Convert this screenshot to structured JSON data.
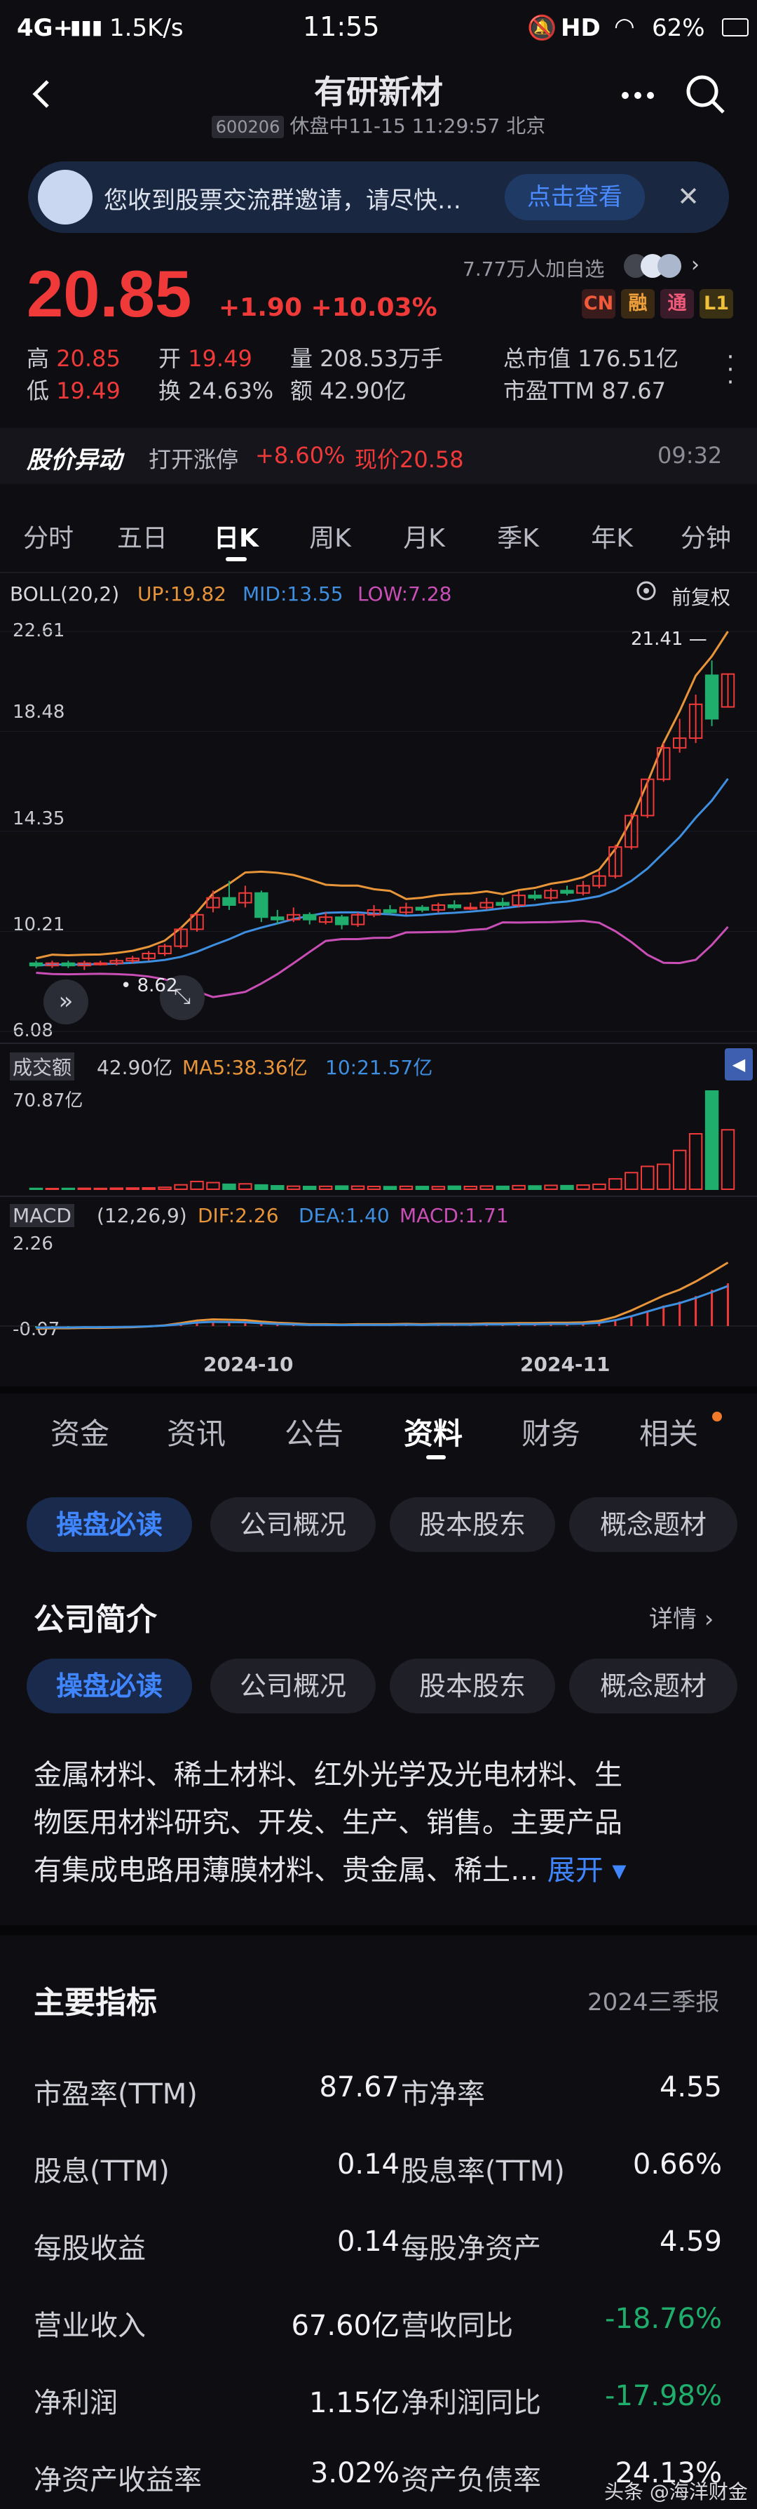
{
  "status_bar": {
    "network": "4G+",
    "speed": "1.5K/s",
    "time": "11:55",
    "right": "HD",
    "battery": "62%"
  },
  "header": {
    "title": "有研新材",
    "code": "600206",
    "status": "休盘中11-15 11:29:57 北京"
  },
  "banner": {
    "text": "您收到股票交流群邀请，请尽快…",
    "action": "点击查看"
  },
  "quote": {
    "price": "20.85",
    "change": "+1.90",
    "change_pct": "+10.03%",
    "watchers": "7.77万人加自选",
    "tags": [
      "CN",
      "融",
      "通",
      "L1"
    ],
    "stats": [
      {
        "label": "高",
        "value": "20.85",
        "color": "red"
      },
      {
        "label": "开",
        "value": "19.49",
        "color": "red"
      },
      {
        "label": "量",
        "value": "208.53万手",
        "color": "plain"
      },
      {
        "label": "总市值",
        "value": "176.51亿",
        "color": "plain"
      },
      {
        "label": "低",
        "value": "19.49",
        "color": "red"
      },
      {
        "label": "换",
        "value": "24.63%",
        "color": "plain"
      },
      {
        "label": "额",
        "value": "42.90亿",
        "color": "plain"
      },
      {
        "label": "市盈TTM",
        "value": "87.67",
        "color": "plain"
      }
    ]
  },
  "alert": {
    "title": "股价异动",
    "text": "打开涨停",
    "pct": "+8.60%",
    "price": "现价20.58",
    "time": "09:32"
  },
  "period_tabs": [
    "分时",
    "五日",
    "日K",
    "周K",
    "月K",
    "季K",
    "年K",
    "分钟"
  ],
  "period_active": 2,
  "chart": {
    "boll_label": "BOLL(20,2)",
    "up": "UP:19.82",
    "mid": "MID:13.55",
    "low": "LOW:7.28",
    "adjust": "前复权",
    "y_ticks": [
      "22.61",
      "18.48",
      "14.35",
      "10.21",
      "6.08"
    ],
    "high_mark": "21.41",
    "low_mark": "8.62",
    "vol_label": "成交额",
    "vol_value": "42.90亿",
    "ma5": "MA5:38.36亿",
    "ma10": "10:21.57亿",
    "vol_max": "70.87亿",
    "macd_label": "MACD",
    "macd_params": "(12,26,9)",
    "dif": "DIF:2.26",
    "dea": "DEA:1.40",
    "macd": "MACD:1.71",
    "macd_top": "2.26",
    "macd_bottom": "-0.07",
    "x_labels": [
      "2024-10",
      "2024-11"
    ],
    "colors": {
      "up": "#f03a3a",
      "down": "#1fae6c",
      "upper": "#e8953a",
      "mid": "#3e8fe0",
      "lower": "#c94fb7"
    }
  },
  "chart_data": {
    "type": "candlestick",
    "title": "",
    "ylim": [
      6.08,
      22.61
    ],
    "candles": [
      {
        "o": 8.9,
        "c": 8.8,
        "h": 9.0,
        "l": 8.7
      },
      {
        "o": 8.8,
        "c": 8.9,
        "h": 9.0,
        "l": 8.7
      },
      {
        "o": 8.9,
        "c": 8.8,
        "h": 9.0,
        "l": 8.7
      },
      {
        "o": 8.8,
        "c": 8.9,
        "h": 9.0,
        "l": 8.62
      },
      {
        "o": 8.9,
        "c": 8.9,
        "h": 9.0,
        "l": 8.8
      },
      {
        "o": 8.9,
        "c": 9.0,
        "h": 9.1,
        "l": 8.8
      },
      {
        "o": 9.0,
        "c": 9.1,
        "h": 9.2,
        "l": 8.9
      },
      {
        "o": 9.1,
        "c": 9.3,
        "h": 9.4,
        "l": 9.0
      },
      {
        "o": 9.3,
        "c": 9.6,
        "h": 9.7,
        "l": 9.2
      },
      {
        "o": 9.6,
        "c": 10.3,
        "h": 10.4,
        "l": 9.5
      },
      {
        "o": 10.3,
        "c": 10.9,
        "h": 11.0,
        "l": 10.2
      },
      {
        "o": 11.2,
        "c": 11.6,
        "h": 11.9,
        "l": 11.0
      },
      {
        "o": 11.6,
        "c": 11.3,
        "h": 12.3,
        "l": 11.1
      },
      {
        "o": 11.4,
        "c": 11.8,
        "h": 12.1,
        "l": 11.2
      },
      {
        "o": 11.8,
        "c": 10.8,
        "h": 11.9,
        "l": 10.6
      },
      {
        "o": 10.8,
        "c": 10.7,
        "h": 11.1,
        "l": 10.5
      },
      {
        "o": 10.7,
        "c": 10.9,
        "h": 11.2,
        "l": 10.6
      },
      {
        "o": 10.9,
        "c": 10.7,
        "h": 11.0,
        "l": 10.5
      },
      {
        "o": 10.6,
        "c": 10.8,
        "h": 11.0,
        "l": 10.5
      },
      {
        "o": 10.8,
        "c": 10.5,
        "h": 10.9,
        "l": 10.3
      },
      {
        "o": 10.5,
        "c": 10.9,
        "h": 11.0,
        "l": 10.4
      },
      {
        "o": 10.9,
        "c": 11.1,
        "h": 11.3,
        "l": 10.8
      },
      {
        "o": 11.1,
        "c": 11.0,
        "h": 11.3,
        "l": 10.9
      },
      {
        "o": 11.0,
        "c": 11.2,
        "h": 11.4,
        "l": 10.9
      },
      {
        "o": 11.2,
        "c": 11.1,
        "h": 11.3,
        "l": 11.0
      },
      {
        "o": 11.1,
        "c": 11.3,
        "h": 11.4,
        "l": 11.0
      },
      {
        "o": 11.3,
        "c": 11.2,
        "h": 11.5,
        "l": 11.1
      },
      {
        "o": 11.2,
        "c": 11.2,
        "h": 11.4,
        "l": 11.1
      },
      {
        "o": 11.2,
        "c": 11.4,
        "h": 11.6,
        "l": 11.1
      },
      {
        "o": 11.4,
        "c": 11.3,
        "h": 11.6,
        "l": 11.2
      },
      {
        "o": 11.3,
        "c": 11.7,
        "h": 11.9,
        "l": 11.2
      },
      {
        "o": 11.7,
        "c": 11.6,
        "h": 11.9,
        "l": 11.5
      },
      {
        "o": 11.6,
        "c": 11.9,
        "h": 12.0,
        "l": 11.5
      },
      {
        "o": 11.9,
        "c": 11.8,
        "h": 12.1,
        "l": 11.7
      },
      {
        "o": 11.8,
        "c": 12.1,
        "h": 12.3,
        "l": 11.7
      },
      {
        "o": 12.1,
        "c": 12.5,
        "h": 12.7,
        "l": 12.0
      },
      {
        "o": 12.5,
        "c": 13.7,
        "h": 13.8,
        "l": 12.4
      },
      {
        "o": 13.7,
        "c": 15.0,
        "h": 15.1,
        "l": 13.6
      },
      {
        "o": 15.0,
        "c": 16.5,
        "h": 16.5,
        "l": 14.9
      },
      {
        "o": 16.5,
        "c": 17.8,
        "h": 18.0,
        "l": 16.4
      },
      {
        "o": 17.8,
        "c": 18.2,
        "h": 19.0,
        "l": 17.6
      },
      {
        "o": 18.2,
        "c": 19.6,
        "h": 20.0,
        "l": 18.0
      },
      {
        "o": 20.8,
        "c": 19.0,
        "h": 21.41,
        "l": 18.7
      },
      {
        "o": 19.49,
        "c": 20.85,
        "h": 20.85,
        "l": 19.49
      }
    ],
    "volume": [
      0.6,
      0.5,
      0.6,
      0.7,
      0.6,
      0.8,
      0.9,
      1.0,
      1.4,
      3.2,
      5.6,
      4.8,
      3.6,
      3.9,
      3.1,
      2.5,
      2.2,
      2.0,
      2.1,
      2.3,
      2.2,
      2.0,
      1.9,
      2.1,
      2.0,
      1.9,
      2.2,
      2.0,
      2.3,
      2.1,
      2.6,
      2.4,
      2.8,
      2.6,
      3.0,
      3.6,
      7.5,
      12.0,
      16.5,
      18.0,
      28.0,
      40.0,
      70.87,
      42.9
    ],
    "macd": [
      -0.07,
      -0.06,
      -0.06,
      -0.05,
      -0.05,
      -0.04,
      -0.03,
      -0.01,
      0.02,
      0.08,
      0.15,
      0.18,
      0.17,
      0.16,
      0.12,
      0.09,
      0.07,
      0.05,
      0.05,
      0.04,
      0.05,
      0.05,
      0.05,
      0.06,
      0.05,
      0.06,
      0.06,
      0.06,
      0.07,
      0.07,
      0.08,
      0.08,
      0.09,
      0.09,
      0.1,
      0.14,
      0.25,
      0.42,
      0.62,
      0.82,
      0.98,
      1.2,
      1.45,
      1.71
    ]
  },
  "bottom_tabs": [
    "资金",
    "资讯",
    "公告",
    "资料",
    "财务",
    "相关"
  ],
  "bottom_active": 3,
  "pills": [
    "操盘必读",
    "公司概况",
    "股本股东",
    "概念题材"
  ],
  "company": {
    "title": "公司简介",
    "details": "详情",
    "line1": "金属材料、稀土材料、红外光学及光电材料、生",
    "line2": "物医用材料研究、开发、生产、销售。主要产品",
    "line3": "有集成电路用薄膜材料、贵金属、稀土…",
    "expand": "展开"
  },
  "indicators": {
    "title": "主要指标",
    "period": "2024三季报",
    "rows": [
      [
        {
          "label": "市盈率(TTM)",
          "value": "87.67",
          "color": "plain"
        },
        {
          "label": "市净率",
          "value": "4.55",
          "color": "plain"
        }
      ],
      [
        {
          "label": "股息(TTM)",
          "value": "0.14",
          "color": "plain"
        },
        {
          "label": "股息率(TTM)",
          "value": "0.66%",
          "color": "plain"
        }
      ],
      [
        {
          "label": "每股收益",
          "value": "0.14",
          "color": "plain"
        },
        {
          "label": "每股净资产",
          "value": "4.59",
          "color": "plain"
        }
      ],
      [
        {
          "label": "营业收入",
          "value": "67.60亿",
          "color": "plain"
        },
        {
          "label": "营收同比",
          "value": "-18.76%",
          "color": "green"
        }
      ],
      [
        {
          "label": "净利润",
          "value": "1.15亿",
          "color": "plain"
        },
        {
          "label": "净利润同比",
          "value": "-17.98%",
          "color": "green"
        }
      ],
      [
        {
          "label": "净资产收益率",
          "value": "3.02%",
          "color": "plain"
        },
        {
          "label": "资产负债率",
          "value": "24.13%",
          "color": "plain"
        }
      ]
    ]
  },
  "watermark": "头条 @海洋财金"
}
